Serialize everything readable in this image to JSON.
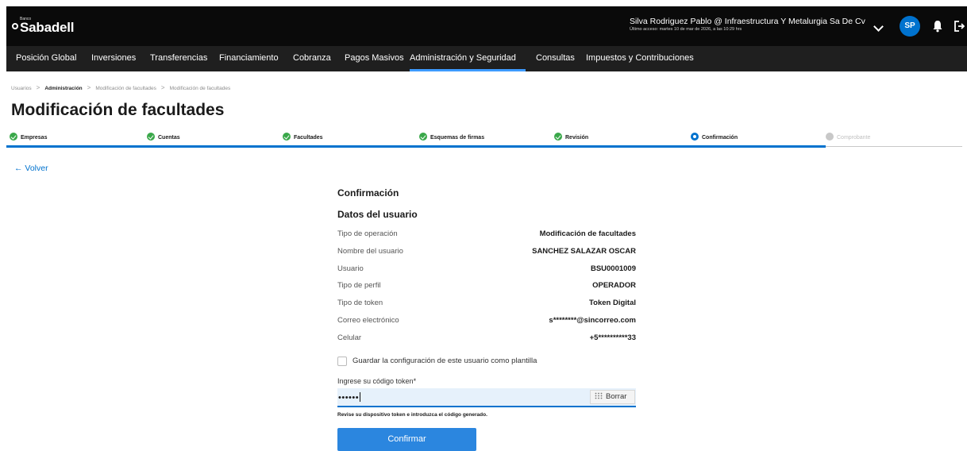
{
  "header": {
    "brand_small": "Banco",
    "brand": "Sabadell",
    "user_name": "Silva Rodriguez Pablo @ Infraestructura Y Metalurgia Sa De Cv",
    "last_access": "Último acceso: martes 10 de mar de 2026, a las 10:29 hrs",
    "avatar_initials": "SP"
  },
  "nav": {
    "items": [
      "Posición Global",
      "Inversiones",
      "Transferencias",
      "Financiamiento",
      "Cobranza",
      "Pagos Masivos",
      "Administración y Seguridad",
      "Consultas",
      "Impuestos y Contribuciones"
    ],
    "active": "Administración y Seguridad"
  },
  "breadcrumb": [
    "Usuarios",
    "Administración",
    "Modificación de facultades",
    "Modificación de facultades"
  ],
  "page_title": "Modificación de facultades",
  "steps": [
    {
      "label": "Empresas",
      "state": "done"
    },
    {
      "label": "Cuentas",
      "state": "done"
    },
    {
      "label": "Facultades",
      "state": "done"
    },
    {
      "label": "Esquemas de firmas",
      "state": "done"
    },
    {
      "label": "Revisión",
      "state": "done"
    },
    {
      "label": "Confirmación",
      "state": "current"
    },
    {
      "label": "Comprobante",
      "state": "pending"
    }
  ],
  "back_label": "← Volver",
  "form": {
    "title": "Confirmación",
    "subtitle": "Datos del usuario",
    "rows": [
      {
        "label": "Tipo de operación",
        "value": "Modificación de facultades"
      },
      {
        "label": "Nombre del usuario",
        "value": "SANCHEZ SALAZAR OSCAR"
      },
      {
        "label": "Usuario",
        "value": "BSU0001009"
      },
      {
        "label": "Tipo de perfil",
        "value": "OPERADOR"
      },
      {
        "label": "Tipo de token",
        "value": "Token Digital"
      },
      {
        "label": "Correo electrónico",
        "value": "s********@sincorreo.com"
      },
      {
        "label": "Celular",
        "value": "+5**********33"
      }
    ],
    "checkbox_label": "Guardar la configuración de este usuario como plantilla",
    "token_label": "Ingrese su código token*",
    "token_value": "••••••",
    "clear_label": "Borrar",
    "hint": "Revise su dispositivo token e introduzca el código generado.",
    "confirm_label": "Confirmar"
  },
  "colors": {
    "accent": "#0072ce",
    "button": "#2b86df",
    "success": "#3aa84a",
    "header_bg": "#0a0a0a",
    "nav_bg": "#1f1f1f"
  }
}
